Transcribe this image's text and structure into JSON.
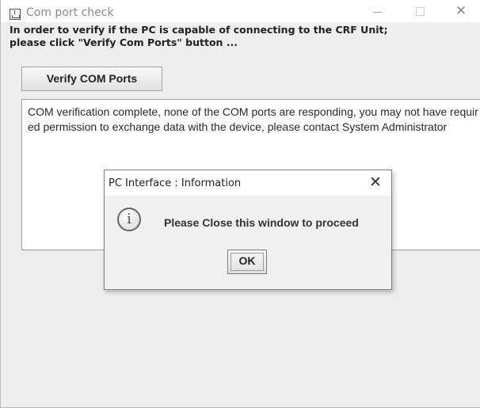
{
  "window": {
    "title": "Com port check",
    "icon": "java-cup-icon",
    "controls": {
      "minimize": "–",
      "maximize": "□",
      "close": "✕"
    }
  },
  "instructions": {
    "line1": "In order to verify if the PC is capable of connecting to the CRF Unit;",
    "line2": "please click \"Verify Com Ports\" button ..."
  },
  "verify_button": {
    "label": "Verify COM Ports"
  },
  "output": {
    "text": "COM verification complete, none of the COM ports are responding, you may not have required permission to exchange data with the device, please contact System Administrator"
  },
  "dialog": {
    "title": "PC Interface : Information",
    "close": "✕",
    "icon": "information-icon",
    "icon_glyph": "i",
    "message": "Please Close this window to proceed",
    "ok_label": "OK"
  }
}
